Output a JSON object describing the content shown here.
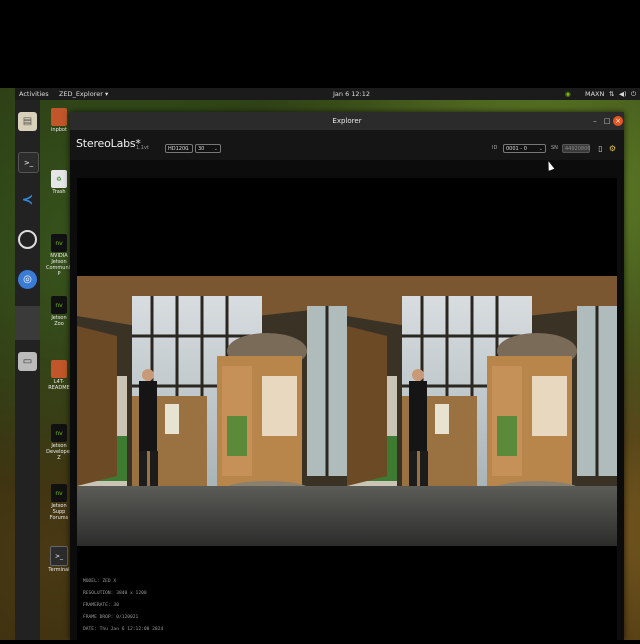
{
  "topbar": {
    "activities": "Activities",
    "app_menu": "ZED_Explorer ▾",
    "clock": "Jan 6  12:12",
    "power_mode": "MAXN",
    "status_icons": [
      "nvidia-icon",
      "network-icon",
      "volume-icon",
      "power-icon",
      "chevron-down-icon"
    ]
  },
  "dock": {
    "apps": [
      "files-icon",
      "terminal-icon",
      "vscode-icon",
      "obs-icon",
      "chromium-icon",
      "show-apps-icon",
      "disk-icon"
    ]
  },
  "desktop_icons": [
    {
      "label": "inpbot"
    },
    {
      "label": "Trash"
    },
    {
      "label": "NVIDIA Jetson\nCommunity P"
    },
    {
      "label": "Jetson Zoo"
    },
    {
      "label": "L4T-README"
    },
    {
      "label": "Jetson\nDeveloper Z"
    },
    {
      "label": "Jetson Supp\nForums"
    },
    {
      "label": "Terminal"
    }
  ],
  "window": {
    "title": "Explorer",
    "brand": "StereoLabs*",
    "version": "1.1vt",
    "resolution_select": "HD1200",
    "fps_select": "30",
    "id_label": "ID",
    "id_select": "0001 - 0",
    "sn_label": "SN",
    "sn_value": "44920806",
    "toolbar_icons": [
      "record-icon",
      "settings-icon"
    ]
  },
  "info": {
    "model": "MODEL: ZED X",
    "resolution": "RESOLUTION: 3840 x 1200",
    "framerate": "FRAMERATE: 30",
    "frame_drop": "FRAME DROP: 0/120021",
    "date": "DATE: Thu Jan 6 12:12:08 2024"
  },
  "colors": {
    "window_bg": "#0c0c0c",
    "titlebar_bg": "#2b2b2b",
    "close_button": "#e95420",
    "dock_bg": "#222222"
  }
}
